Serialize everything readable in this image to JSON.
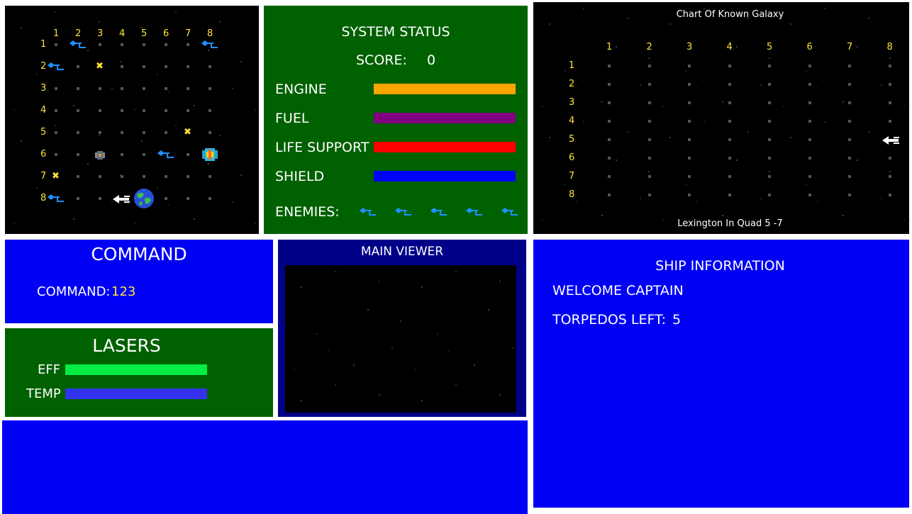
{
  "local_map": {
    "col_labels": [
      "1",
      "2",
      "3",
      "4",
      "5",
      "6",
      "7",
      "8"
    ],
    "row_labels": [
      "1",
      "2",
      "3",
      "4",
      "5",
      "6",
      "7",
      "8"
    ],
    "klingons": [
      [
        1,
        2
      ],
      [
        1,
        8
      ],
      [
        2,
        1
      ],
      [
        6,
        6
      ],
      [
        8,
        1
      ]
    ],
    "stars_x": [
      [
        2,
        3
      ],
      [
        5,
        7
      ],
      [
        7,
        1
      ]
    ],
    "starbases": [
      [
        6,
        3
      ],
      [
        6,
        8
      ]
    ],
    "player_ship": [
      8,
      4
    ],
    "planet": [
      8,
      5
    ]
  },
  "system_status": {
    "title": "SYSTEM STATUS",
    "score_label": "SCORE:",
    "score_value": "0",
    "systems": [
      {
        "label": "ENGINE",
        "color": "#ffa500",
        "level": 1.0
      },
      {
        "label": "FUEL",
        "color": "#800080",
        "level": 1.0
      },
      {
        "label": "LIFE SUPPORT",
        "color": "#ff0000",
        "level": 1.0
      },
      {
        "label": "SHIELD",
        "color": "#0000ff",
        "level": 1.0
      }
    ],
    "enemies_label": "ENEMIES:",
    "enemies_count": 5
  },
  "galaxy": {
    "title": "Chart Of Known Galaxy",
    "col_labels": [
      "1",
      "2",
      "3",
      "4",
      "5",
      "6",
      "7",
      "8"
    ],
    "row_labels": [
      "1",
      "2",
      "3",
      "4",
      "5",
      "6",
      "7",
      "8"
    ],
    "ship_quadrant": [
      5,
      8
    ],
    "footer": "Lexington In Quad 5 -7"
  },
  "command": {
    "title": "COMMAND",
    "label": "COMMAND:",
    "value": "123"
  },
  "lasers": {
    "title": "LASERS",
    "eff_label": "EFF",
    "eff_color": "#00ee44",
    "eff_level": 1.0,
    "temp_label": "TEMP",
    "temp_color": "#3333ee",
    "temp_level": 1.0
  },
  "viewer": {
    "title": "MAIN VIEWER"
  },
  "ship_info": {
    "title": "SHIP INFORMATION",
    "welcome": "WELCOME CAPTAIN",
    "torpedos_label": "TORPEDOS LEFT:",
    "torpedos_value": "5"
  },
  "colors": {
    "panel_blue": "#0000f5",
    "panel_green": "#006100",
    "viewer_navy": "#000089",
    "label_yellow": "#ffe23a"
  }
}
